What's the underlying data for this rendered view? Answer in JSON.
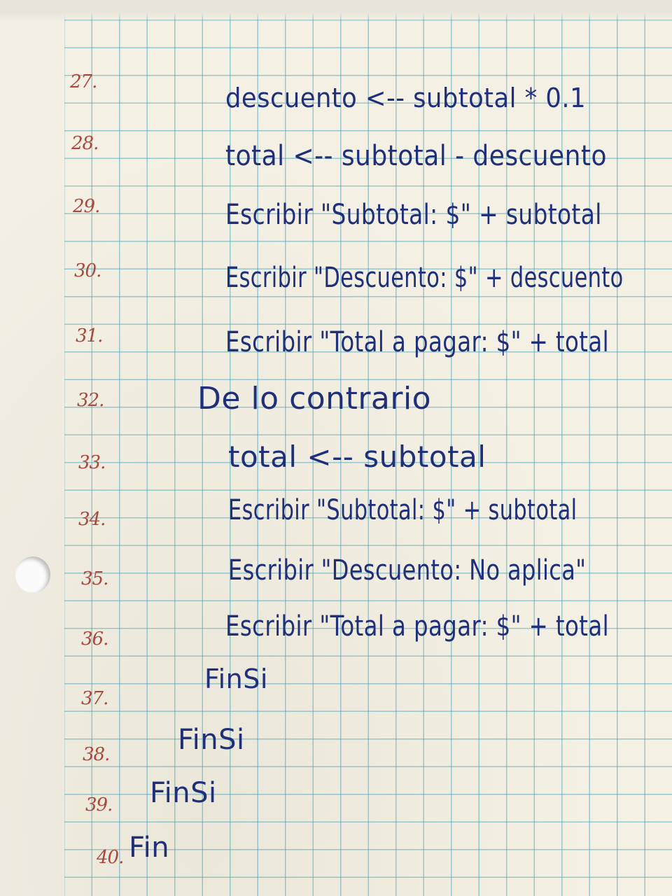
{
  "lines": [
    {
      "num": "27.",
      "text": "descuento <-- subtotal * 0.1"
    },
    {
      "num": "28.",
      "text": "total <-- subtotal - descuento"
    },
    {
      "num": "29.",
      "text": "Escribir \"Subtotal: $\" + subtotal"
    },
    {
      "num": "30.",
      "text": "Escribir \"Descuento: $\" + descuento"
    },
    {
      "num": "31.",
      "text": "Escribir \"Total a pagar: $\" + total"
    },
    {
      "num": "32.",
      "text": "De lo contrario"
    },
    {
      "num": "33.",
      "text": "total <-- subtotal"
    },
    {
      "num": "34.",
      "text": "Escribir \"Subtotal: $\" + subtotal"
    },
    {
      "num": "35.",
      "text": "Escribir \"Descuento: No aplica\""
    },
    {
      "num": "36.",
      "text": "Escribir \"Total a pagar: $\" + total"
    },
    {
      "num": "37.",
      "text": "FinSi"
    },
    {
      "num": "38.",
      "text": "FinSi"
    },
    {
      "num": "39.",
      "text": "FinSi"
    },
    {
      "num": "40.",
      "text": "Fin"
    }
  ],
  "colors": {
    "ink": "#1f2f7a",
    "margin_numbers": "#a8473b",
    "grid": "#50a5be",
    "paper": "#f4f1e4"
  }
}
